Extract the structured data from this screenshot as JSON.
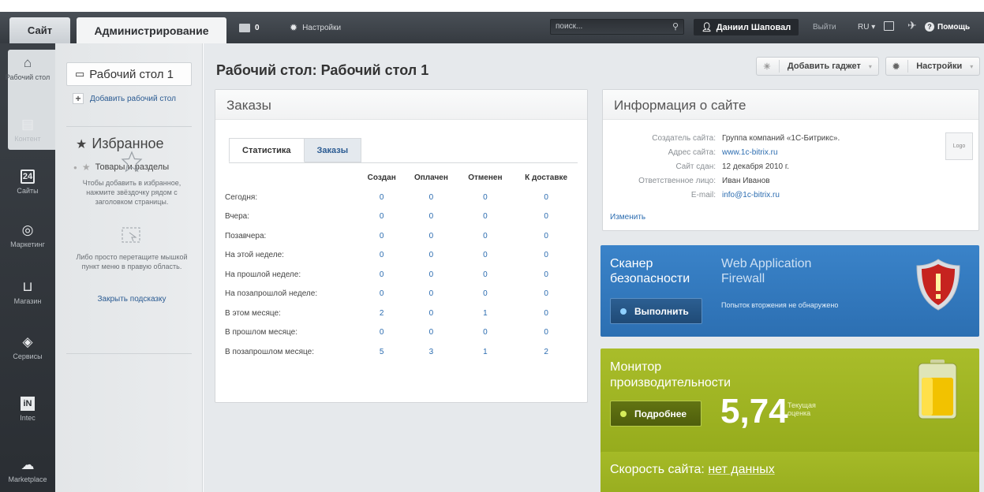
{
  "topbar": {
    "site_tab": "Сайт",
    "admin_tab": "Администрирование",
    "notify_count": "0",
    "settings": "Настройки",
    "search_placeholder": "поиск...",
    "user": "Даниил Шаповал",
    "logout": "Выйти",
    "lang": "RU",
    "help": "Помощь"
  },
  "leftmenu": {
    "items": [
      {
        "label": "Рабочий стол",
        "icon": "home-icon"
      },
      {
        "label": "Контент",
        "icon": "document-icon"
      },
      {
        "label": "Сайты",
        "icon": "calendar-icon",
        "icon_text": "24"
      },
      {
        "label": "Маркетинг",
        "icon": "target-icon"
      },
      {
        "label": "Магазин",
        "icon": "basket-icon"
      },
      {
        "label": "Сервисы",
        "icon": "layers-icon"
      },
      {
        "label": "Intec",
        "icon": "intec-icon",
        "icon_text": "iN"
      },
      {
        "label": "Marketplace",
        "icon": "cloud-download-icon"
      }
    ]
  },
  "sidebar": {
    "desktop": "Рабочий стол 1",
    "add_desktop": "Добавить рабочий стол",
    "favorites_title": "Избранное",
    "favorites_item": "Товары и разделы",
    "hint1": "Чтобы добавить в избранное, нажмите звёздочку рядом с заголовком страницы.",
    "hint2": "Либо просто перетащите мышкой пункт меню в правую область.",
    "close_hint": "Закрыть подсказку"
  },
  "main": {
    "title": "Рабочий стол: Рабочий стол 1",
    "add_gadget": "Добавить гаджет",
    "settings": "Настройки"
  },
  "orders": {
    "title": "Заказы",
    "tabs": [
      "Статистика",
      "Заказы"
    ],
    "columns": [
      "",
      "Создан",
      "Оплачен",
      "Отменен",
      "К доставке"
    ],
    "rows": [
      [
        "Сегодня:",
        "0",
        "0",
        "0",
        "0"
      ],
      [
        "Вчера:",
        "0",
        "0",
        "0",
        "0"
      ],
      [
        "Позавчера:",
        "0",
        "0",
        "0",
        "0"
      ],
      [
        "На этой неделе:",
        "0",
        "0",
        "0",
        "0"
      ],
      [
        "На прошлой неделе:",
        "0",
        "0",
        "0",
        "0"
      ],
      [
        "На позапрошлой неделе:",
        "0",
        "0",
        "0",
        "0"
      ],
      [
        "В этом месяце:",
        "2",
        "0",
        "1",
        "0"
      ],
      [
        "В прошлом месяце:",
        "0",
        "0",
        "0",
        "0"
      ],
      [
        "В позапрошлом месяце:",
        "5",
        "3",
        "1",
        "2"
      ]
    ]
  },
  "site_info": {
    "title": "Информация о сайте",
    "rows": [
      {
        "label": "Создатель сайта:",
        "value": "Группа компаний «1С-Битрикс».",
        "link": false
      },
      {
        "label": "Адрес сайта:",
        "value": "www.1c-bitrix.ru",
        "link": true
      },
      {
        "label": "Сайт сдан:",
        "value": "12 декабря 2010 г.",
        "link": false
      },
      {
        "label": "Ответственное лицо:",
        "value": "Иван Иванов",
        "link": false
      },
      {
        "label": "E-mail:",
        "value": "info@1c-bitrix.ru",
        "link": true
      }
    ],
    "logo": "Logo",
    "edit": "Изменить"
  },
  "scanner": {
    "title_line1": "Сканер",
    "title_line2": "безопасности",
    "waf_line1": "Web Application",
    "waf_line2": "Firewall",
    "button": "Выполнить",
    "note": "Попыток вторжения не обнаружено"
  },
  "monitor": {
    "title_line1": "Монитор",
    "title_line2": "производительности",
    "button": "Подробнее",
    "score": "5,74",
    "score_label": "Текущая оценка"
  },
  "speed": {
    "label": "Скорость сайта:",
    "value": "нет данных"
  },
  "colors": {
    "topbar": "#3f444a",
    "scanner": "#3478bd",
    "monitor": "#a0b524",
    "link": "#2b6cb0"
  }
}
